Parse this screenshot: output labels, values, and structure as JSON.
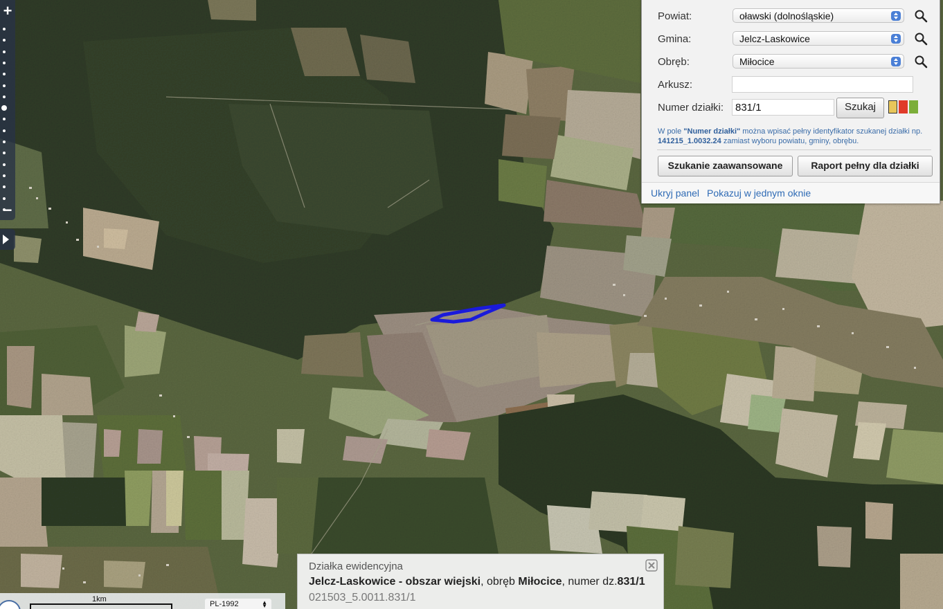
{
  "map": {
    "zoom_in_label": "+",
    "zoom_out_label": "−",
    "zoom_level_active_index": 7,
    "zoom_level_count": 17,
    "parcel_outline_color": "#1a1adb"
  },
  "search_panel": {
    "powiat": {
      "label": "Powiat:",
      "value": "oławski (dolnośląskie)"
    },
    "gmina": {
      "label": "Gmina:",
      "value": "Jelcz-Laskowice"
    },
    "obreb": {
      "label": "Obręb:",
      "value": "Miłocice"
    },
    "arkusz": {
      "label": "Arkusz:",
      "value": ""
    },
    "parcel_number": {
      "label": "Numer działki:",
      "value": "831/1"
    },
    "search_button": "Szukaj",
    "swatch_colors": [
      "#e8c65a",
      "#e03b2a",
      "#7cae3a"
    ],
    "hint": {
      "part1": "W pole ",
      "field_name": "\"Numer działki\"",
      "part2": " można wpisać pełny identyfikator szukanej działki np. ",
      "example_id": "141215_1.0032.24",
      "part3": " zamiast wyboru powiatu, gminy, obrębu."
    },
    "advanced_search_button": "Szukanie zaawansowane",
    "full_report_button": "Raport pełny dla działki",
    "hide_panel_link": "Ukryj panel",
    "single_window_link": "Pokazuj w jednym oknie",
    "link_color": "#2f6bb5"
  },
  "scale": {
    "label": "1km",
    "crs": "PL-1992"
  },
  "info_box": {
    "heading": "Działka ewidencyjna",
    "municipality": "Jelcz-Laskowice - obszar wiejski",
    "sep1": ", obręb ",
    "precinct": "Miłocice",
    "sep2": ", numer dz.",
    "parcel_number": "831/1",
    "parcel_id": "021503_5.0011.831/1"
  }
}
